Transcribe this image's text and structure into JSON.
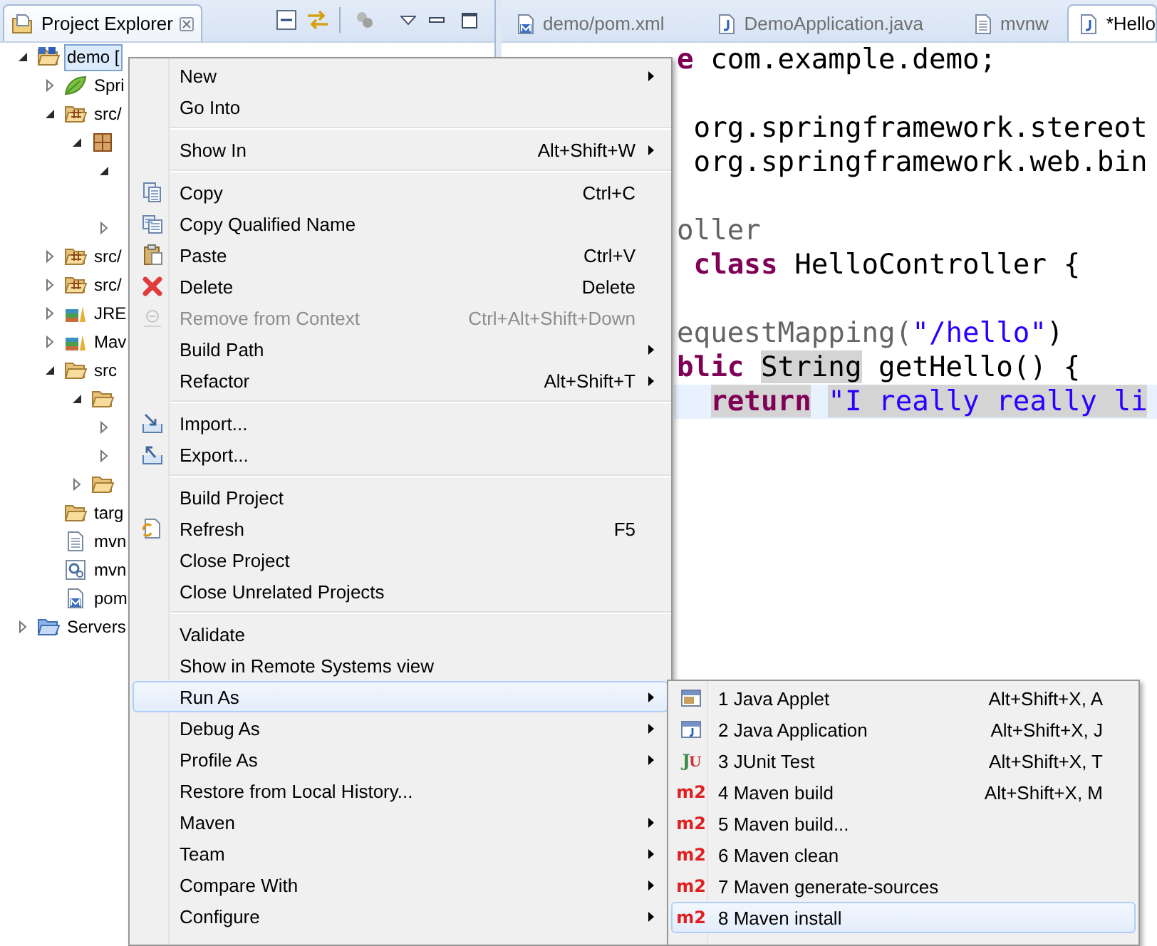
{
  "explorer": {
    "title": "Project Explorer",
    "tree": [
      {
        "label": "demo [",
        "kind": "project",
        "expanded": true,
        "selected": true,
        "children": [
          {
            "label": "Spri",
            "kind": "spring",
            "expanded": false,
            "selected": false
          },
          {
            "label": "src/",
            "kind": "source-folder",
            "expanded": true,
            "selected": false,
            "children": [
              {
                "kind": "package",
                "expanded": true,
                "children": [
                  {
                    "expanded": true
                  },
                  {
                    "expanded": false
                  }
                ]
              }
            ]
          },
          {
            "label": "src/",
            "kind": "source-folder",
            "expanded": false,
            "selected": false
          },
          {
            "label": "src/",
            "kind": "source-folder",
            "expanded": false,
            "selected": false
          },
          {
            "label": "JRE",
            "kind": "library",
            "expanded": false,
            "selected": false
          },
          {
            "label": "Mav",
            "kind": "library",
            "expanded": false,
            "selected": false
          },
          {
            "label": "src",
            "kind": "folder",
            "expanded": true,
            "selected": false,
            "children": [
              {
                "kind": "folder",
                "expanded": true,
                "children": [
                  {
                    "expanded": false
                  },
                  {
                    "expanded": false
                  }
                ]
              },
              {
                "kind": "folder",
                "expanded": false
              }
            ]
          },
          {
            "label": "targ",
            "kind": "folder",
            "selected": false
          },
          {
            "label": "mvn",
            "kind": "text-file",
            "selected": false
          },
          {
            "label": "mvn",
            "kind": "settings-file",
            "selected": false
          },
          {
            "label": "pom",
            "kind": "maven-file",
            "selected": false
          }
        ]
      },
      {
        "label": "Servers",
        "kind": "server-folder",
        "expanded": false,
        "selected": false
      }
    ]
  },
  "editor": {
    "tabs": [
      {
        "label": "demo/pom.xml",
        "kind": "maven-file",
        "selected": false
      },
      {
        "label": "DemoApplication.java",
        "kind": "java-file",
        "selected": false
      },
      {
        "label": "mvnw",
        "kind": "text-file",
        "selected": false
      },
      {
        "label": "*Hello",
        "kind": "java-file",
        "selected": true
      }
    ],
    "lines": [
      {
        "kind": "code",
        "current": false,
        "tokens": [
          {
            "text": "e",
            "kind": "keyword",
            "marked": false
          },
          {
            "text": " com.example.demo;",
            "kind": "plain",
            "marked": false
          }
        ]
      },
      {
        "kind": "blank"
      },
      {
        "kind": "code",
        "current": false,
        "tokens": [
          {
            "text": " org.springframework.stereot",
            "kind": "plain",
            "marked": false
          }
        ]
      },
      {
        "kind": "code",
        "current": false,
        "tokens": [
          {
            "text": " org.springframework.web.bin",
            "kind": "plain",
            "marked": false
          }
        ]
      },
      {
        "kind": "blank"
      },
      {
        "kind": "code",
        "current": false,
        "tokens": [
          {
            "text": "oller",
            "kind": "annotation",
            "marked": false
          }
        ]
      },
      {
        "kind": "code",
        "current": false,
        "tokens": [
          {
            "text": " class",
            "kind": "keyword",
            "marked": false
          },
          {
            "text": " HelloController {",
            "kind": "plain",
            "marked": false
          }
        ]
      },
      {
        "kind": "blank"
      },
      {
        "kind": "code",
        "current": false,
        "tokens": [
          {
            "text": "equestMapping(",
            "kind": "annotation",
            "marked": false
          },
          {
            "text": "\"/hello\"",
            "kind": "string",
            "marked": false
          },
          {
            "text": ")",
            "kind": "plain",
            "marked": false
          }
        ]
      },
      {
        "kind": "code",
        "current": false,
        "tokens": [
          {
            "text": "blic ",
            "kind": "keyword",
            "marked": false
          },
          {
            "text": "String",
            "kind": "plain",
            "marked": true
          },
          {
            "text": " getHello() {",
            "kind": "plain",
            "marked": false
          }
        ]
      },
      {
        "kind": "code",
        "current": true,
        "tokens": [
          {
            "text": "  return",
            "kind": "keyword",
            "marked": true
          },
          {
            "text": " \"I really really li",
            "kind": "string",
            "marked": true
          }
        ]
      }
    ]
  },
  "context_menu": {
    "groups": [
      {
        "items": [
          {
            "label": "New",
            "kind": "none",
            "submenu": true,
            "disabled": false,
            "selected": false
          },
          {
            "label": "Go Into",
            "kind": "none",
            "submenu": false,
            "disabled": false,
            "selected": false
          }
        ]
      },
      {
        "items": [
          {
            "label": "Show In",
            "shortcut": "Alt+Shift+W",
            "kind": "none",
            "submenu": true,
            "disabled": false,
            "selected": false
          }
        ]
      },
      {
        "items": [
          {
            "label": "Copy",
            "shortcut": "Ctrl+C",
            "kind": "copy",
            "submenu": false,
            "disabled": false,
            "selected": false
          },
          {
            "label": "Copy Qualified Name",
            "kind": "copy-name",
            "submenu": false,
            "disabled": false,
            "selected": false
          },
          {
            "label": "Paste",
            "shortcut": "Ctrl+V",
            "kind": "paste",
            "submenu": false,
            "disabled": false,
            "selected": false
          },
          {
            "label": "Delete",
            "shortcut": "Delete",
            "kind": "delete",
            "submenu": false,
            "disabled": false,
            "selected": false
          },
          {
            "label": "Remove from Context",
            "shortcut": "Ctrl+Alt+Shift+Down",
            "kind": "remove",
            "submenu": false,
            "disabled": true,
            "selected": false
          },
          {
            "label": "Build Path",
            "kind": "none",
            "submenu": true,
            "disabled": false,
            "selected": false
          },
          {
            "label": "Refactor",
            "shortcut": "Alt+Shift+T",
            "kind": "none",
            "submenu": true,
            "disabled": false,
            "selected": false
          }
        ]
      },
      {
        "items": [
          {
            "label": "Import...",
            "kind": "import",
            "submenu": false,
            "disabled": false,
            "selected": false
          },
          {
            "label": "Export...",
            "kind": "export",
            "submenu": false,
            "disabled": false,
            "selected": false
          }
        ]
      },
      {
        "items": [
          {
            "label": "Build Project",
            "kind": "none",
            "submenu": false,
            "disabled": false,
            "selected": false
          },
          {
            "label": "Refresh",
            "shortcut": "F5",
            "kind": "refresh",
            "submenu": false,
            "disabled": false,
            "selected": false
          },
          {
            "label": "Close Project",
            "kind": "none",
            "submenu": false,
            "disabled": false,
            "selected": false
          },
          {
            "label": "Close Unrelated Projects",
            "kind": "none",
            "submenu": false,
            "disabled": false,
            "selected": false
          }
        ]
      },
      {
        "items": [
          {
            "label": "Validate",
            "kind": "none",
            "submenu": false,
            "disabled": false,
            "selected": false
          },
          {
            "label": "Show in Remote Systems view",
            "kind": "none",
            "submenu": false,
            "disabled": false,
            "selected": false
          },
          {
            "label": "Run As",
            "kind": "none",
            "submenu": true,
            "disabled": false,
            "selected": true
          },
          {
            "label": "Debug As",
            "kind": "none",
            "submenu": true,
            "disabled": false,
            "selected": false
          },
          {
            "label": "Profile As",
            "kind": "none",
            "submenu": true,
            "disabled": false,
            "selected": false
          },
          {
            "label": "Restore from Local History...",
            "kind": "none",
            "submenu": false,
            "disabled": false,
            "selected": false
          },
          {
            "label": "Maven",
            "kind": "none",
            "submenu": true,
            "disabled": false,
            "selected": false
          },
          {
            "label": "Team",
            "kind": "none",
            "submenu": true,
            "disabled": false,
            "selected": false
          },
          {
            "label": "Compare With",
            "kind": "none",
            "submenu": true,
            "disabled": false,
            "selected": false
          },
          {
            "label": "Configure",
            "kind": "none",
            "submenu": true,
            "disabled": false,
            "selected": false
          }
        ]
      }
    ]
  },
  "submenu": {
    "groups": [
      {
        "items": [
          {
            "label": "1 Java Applet",
            "shortcut": "Alt+Shift+X, A",
            "kind": "applet",
            "submenu": false,
            "disabled": false,
            "selected": false
          },
          {
            "label": "2 Java Application",
            "shortcut": "Alt+Shift+X, J",
            "kind": "java-app",
            "submenu": false,
            "disabled": false,
            "selected": false
          },
          {
            "label": "3 JUnit Test",
            "shortcut": "Alt+Shift+X, T",
            "kind": "junit",
            "badge": "JU",
            "submenu": false,
            "disabled": false,
            "selected": false
          },
          {
            "label": "4 Maven build",
            "shortcut": "Alt+Shift+X, M",
            "kind": "maven",
            "badge": "m2",
            "submenu": false,
            "disabled": false,
            "selected": false
          },
          {
            "label": "5 Maven build...",
            "kind": "maven",
            "badge": "m2",
            "submenu": false,
            "disabled": false,
            "selected": false
          },
          {
            "label": "6 Maven clean",
            "kind": "maven",
            "badge": "m2",
            "submenu": false,
            "disabled": false,
            "selected": false
          },
          {
            "label": "7 Maven generate-sources",
            "kind": "maven",
            "badge": "m2",
            "submenu": false,
            "disabled": false,
            "selected": false
          },
          {
            "label": "8 Maven install",
            "kind": "maven",
            "badge": "m2",
            "submenu": false,
            "disabled": false,
            "selected": true
          }
        ]
      }
    ]
  }
}
